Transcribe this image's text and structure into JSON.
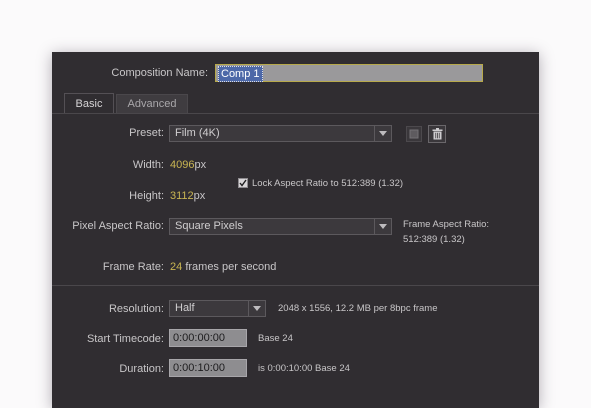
{
  "dialog": {
    "comp_name_label": "Composition Name:",
    "comp_name_value": "Comp 1",
    "tabs": [
      {
        "label": "Basic"
      },
      {
        "label": "Advanced"
      }
    ],
    "preset": {
      "label": "Preset:",
      "value": "Film (4K)",
      "save_icon": "save-preset-icon",
      "delete_icon": "trash-icon"
    },
    "width": {
      "label": "Width:",
      "value": "4096",
      "unit": "px"
    },
    "height": {
      "label": "Height:",
      "value": "3112",
      "unit": "px"
    },
    "lock_aspect": {
      "label": "Lock Aspect Ratio to 512:389 (1.32)",
      "checked": true
    },
    "pixel_aspect": {
      "label": "Pixel Aspect Ratio:",
      "value": "Square Pixels"
    },
    "frame_aspect": {
      "label": "Frame Aspect Ratio:",
      "value": "512:389 (1.32)"
    },
    "frame_rate": {
      "label": "Frame Rate:",
      "value": "24",
      "unit": "frames per second"
    },
    "resolution": {
      "label": "Resolution:",
      "value": "Half",
      "info": "2048 x 1556, 12.2 MB per 8bpc frame"
    },
    "start_timecode": {
      "label": "Start Timecode:",
      "value": "0:00:00:00",
      "base": "Base 24"
    },
    "duration": {
      "label": "Duration:",
      "value": "0:00:10:00",
      "info": "is 0:00:10:00  Base 24"
    }
  }
}
